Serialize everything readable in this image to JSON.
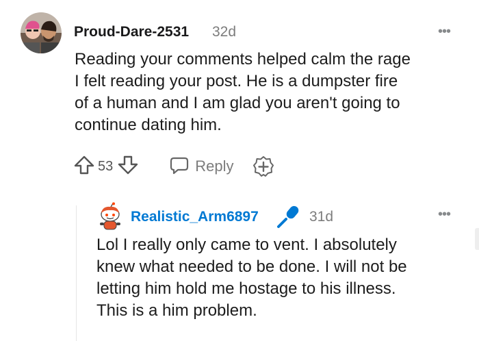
{
  "comment": {
    "username": "Proud-Dare-2531",
    "timestamp": "32d",
    "avatar_icon": "user-photo-avatar",
    "more_label": "•••",
    "lines": [
      "Reading your comments helped calm the rage",
      "I felt reading your post. He is a dumpster fire",
      "of a human and I am glad you aren't going to",
      "continue dating him."
    ],
    "vote_count": "53",
    "reply_label": "Reply",
    "icons": {
      "upvote": "arrow-up-icon",
      "downvote": "arrow-down-icon",
      "reply": "chat-bubble-icon",
      "award": "plus-award-icon",
      "more": "more-dots-icon"
    }
  },
  "reply": {
    "username": "Realistic_Arm6897",
    "timestamp": "31d",
    "avatar_icon": "snoo-avatar",
    "badge_icon": "microphone-icon",
    "more_label": "•••",
    "lines": [
      "Lol I really only came to vent. I absolutely",
      "knew what needed to be done. I will not be",
      "letting him hold me hostage to his illness.",
      "This is a him problem."
    ]
  },
  "colors": {
    "link_blue": "#0079d3",
    "meta_gray": "#7c7c7c",
    "text": "#1c1c1c"
  }
}
